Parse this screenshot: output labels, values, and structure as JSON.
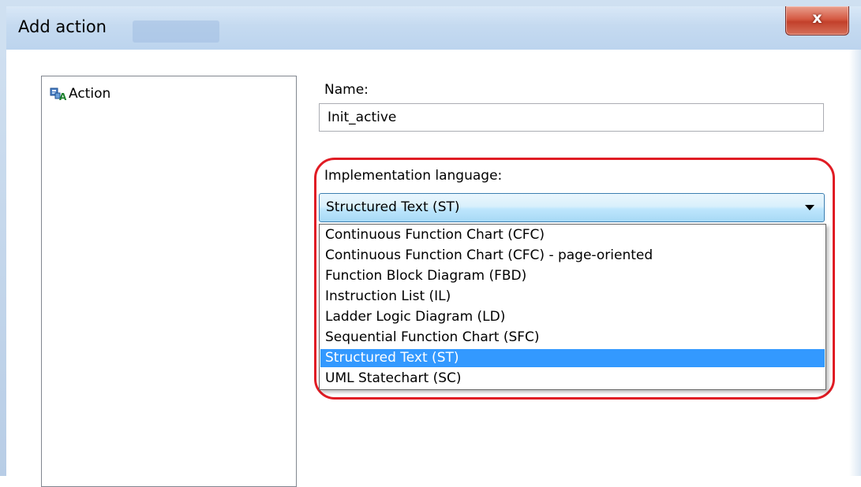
{
  "window": {
    "title": "Add action",
    "close_symbol": "x"
  },
  "tree": {
    "items": [
      {
        "label": "Action",
        "icon": "action-icon"
      }
    ]
  },
  "name_field": {
    "label": "Name:",
    "value": "Init_active"
  },
  "language": {
    "label": "Implementation language:",
    "selected": "Structured Text (ST)",
    "options": [
      "Continuous Function Chart (CFC)",
      "Continuous Function Chart (CFC) - page-oriented",
      "Function Block Diagram (FBD)",
      "Instruction List (IL)",
      "Ladder Logic Diagram (LD)",
      "Sequential Function Chart (SFC)",
      "Structured Text (ST)",
      "UML Statechart (SC)"
    ],
    "highlighted_index": 6
  },
  "colors": {
    "selection": "#3399ff",
    "highlight_outline": "#e01c24",
    "close_button": "#c2402b"
  }
}
